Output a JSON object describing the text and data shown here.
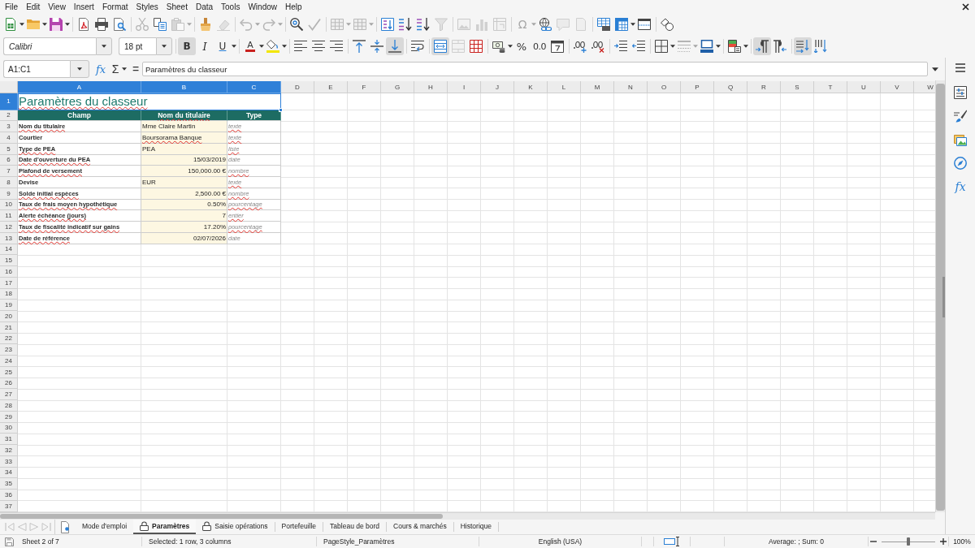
{
  "menu_bar": {
    "items": [
      "File",
      "Edit",
      "View",
      "Insert",
      "Format",
      "Styles",
      "Sheet",
      "Data",
      "Tools",
      "Window",
      "Help"
    ]
  },
  "standard_toolbar": {
    "groups": [
      [
        {
          "kind": "new",
          "disabled": false,
          "dropdown": true
        },
        {
          "kind": "open",
          "disabled": false,
          "dropdown": true
        },
        {
          "kind": "save",
          "disabled": false,
          "dropdown": true
        }
      ],
      [
        {
          "kind": "pdf",
          "disabled": false,
          "dropdown": false
        },
        {
          "kind": "print",
          "disabled": false,
          "dropdown": false
        },
        {
          "kind": "preview",
          "disabled": false,
          "dropdown": false
        }
      ],
      [
        {
          "kind": "cut",
          "disabled": true,
          "dropdown": false
        },
        {
          "kind": "copy",
          "disabled": false,
          "dropdown": false
        },
        {
          "kind": "paste",
          "disabled": true,
          "dropdown": true
        }
      ],
      [
        {
          "kind": "clone",
          "disabled": false,
          "dropdown": false
        },
        {
          "kind": "clear",
          "disabled": true,
          "dropdown": false
        }
      ],
      [
        {
          "kind": "undo",
          "disabled": true,
          "dropdown": true
        },
        {
          "kind": "redo",
          "disabled": true,
          "dropdown": true
        }
      ],
      [
        {
          "kind": "find",
          "disabled": false,
          "dropdown": false
        },
        {
          "kind": "spelling",
          "disabled": true,
          "dropdown": false
        }
      ],
      [
        {
          "kind": "rows",
          "disabled": true,
          "dropdown": true
        },
        {
          "kind": "columns",
          "disabled": true,
          "dropdown": true
        }
      ],
      [
        {
          "kind": "sort",
          "disabled": false,
          "dropdown": false
        },
        {
          "kind": "ascending",
          "disabled": false,
          "dropdown": false
        },
        {
          "kind": "descending",
          "disabled": false,
          "dropdown": false
        },
        {
          "kind": "filter",
          "disabled": true,
          "dropdown": false
        }
      ],
      [
        {
          "kind": "image",
          "disabled": true,
          "dropdown": false
        },
        {
          "kind": "chart",
          "disabled": true,
          "dropdown": false
        },
        {
          "kind": "pivot",
          "disabled": true,
          "dropdown": false
        }
      ],
      [
        {
          "kind": "symbol",
          "label": "Ω",
          "disabled": true,
          "dropdown": true
        },
        {
          "kind": "hyperlink",
          "disabled": false,
          "dropdown": false
        },
        {
          "kind": "comment",
          "disabled": true,
          "dropdown": false
        },
        {
          "kind": "headers",
          "disabled": true,
          "dropdown": false
        }
      ],
      [
        {
          "kind": "printarea",
          "disabled": false,
          "dropdown": false
        },
        {
          "kind": "freeze",
          "disabled": false,
          "dropdown": true
        },
        {
          "kind": "split",
          "disabled": false,
          "dropdown": false
        }
      ],
      [
        {
          "kind": "draw",
          "disabled": false,
          "dropdown": false
        }
      ]
    ]
  },
  "formatting_toolbar": {
    "font_name": "Calibri",
    "font_size": "18 pt",
    "groups": [
      [
        {
          "kind": "bold",
          "label": "B",
          "on": true,
          "disabled": false,
          "dropdown": false
        },
        {
          "kind": "italic",
          "label": "I",
          "on": false,
          "disabled": false,
          "dropdown": false
        },
        {
          "kind": "underline",
          "label": "U",
          "on": false,
          "disabled": false,
          "dropdown": true
        }
      ],
      [
        {
          "kind": "fontcolor",
          "label": "A",
          "on": false,
          "disabled": false,
          "dropdown": true
        },
        {
          "kind": "highlight",
          "on": false,
          "disabled": false,
          "dropdown": true
        }
      ],
      [
        {
          "kind": "left",
          "on": false,
          "disabled": false,
          "dropdown": false
        },
        {
          "kind": "center",
          "on": false,
          "disabled": false,
          "dropdown": false
        },
        {
          "kind": "right",
          "on": false,
          "disabled": false,
          "dropdown": false
        }
      ],
      [
        {
          "kind": "top",
          "on": false,
          "disabled": false,
          "dropdown": false
        },
        {
          "kind": "middle",
          "on": false,
          "disabled": false,
          "dropdown": false
        },
        {
          "kind": "bottom",
          "on": true,
          "disabled": false,
          "dropdown": false
        }
      ],
      [
        {
          "kind": "wrap",
          "on": false,
          "disabled": false,
          "dropdown": false
        }
      ],
      [
        {
          "kind": "merge",
          "on": true,
          "disabled": false,
          "dropdown": false
        },
        {
          "kind": "mergecells",
          "on": false,
          "disabled": true,
          "dropdown": false
        },
        {
          "kind": "unmerge",
          "on": false,
          "disabled": false,
          "dropdown": false
        }
      ],
      [
        {
          "kind": "currency",
          "on": false,
          "disabled": false,
          "dropdown": true
        },
        {
          "kind": "percent",
          "label": "%",
          "on": false,
          "disabled": false,
          "dropdown": false
        },
        {
          "kind": "number",
          "label": "0.0",
          "on": false,
          "disabled": false,
          "dropdown": false
        },
        {
          "kind": "date",
          "on": false,
          "disabled": false,
          "dropdown": false
        }
      ],
      [
        {
          "kind": "adddecimal",
          "on": false,
          "disabled": false,
          "dropdown": false
        },
        {
          "kind": "deletedecimal",
          "on": false,
          "disabled": false,
          "dropdown": false
        }
      ],
      [
        {
          "kind": "indent",
          "on": false,
          "disabled": false,
          "dropdown": false
        },
        {
          "kind": "outdent",
          "on": false,
          "disabled": false,
          "dropdown": false
        }
      ],
      [
        {
          "kind": "borders",
          "on": false,
          "disabled": false,
          "dropdown": true
        },
        {
          "kind": "borderstyle",
          "on": false,
          "disabled": true,
          "dropdown": true
        },
        {
          "kind": "bordercolor",
          "on": false,
          "disabled": false,
          "dropdown": true
        }
      ],
      [
        {
          "kind": "conditional",
          "on": false,
          "disabled": false,
          "dropdown": true
        }
      ],
      [
        {
          "kind": "ltr",
          "on": true,
          "disabled": false,
          "dropdown": false
        },
        {
          "kind": "rtl",
          "on": false,
          "disabled": false,
          "dropdown": false
        }
      ],
      [
        {
          "kind": "horizontal",
          "on": true,
          "disabled": false,
          "dropdown": false
        },
        {
          "kind": "vertical",
          "on": false,
          "disabled": false,
          "dropdown": false
        }
      ]
    ]
  },
  "formula_bar": {
    "name_box": "A1:C1",
    "function_wizard": "fx",
    "sum": "Σ",
    "formula": "=",
    "content": "Paramètres du classeur"
  },
  "sheet": {
    "column_headers": [
      {
        "label": "A",
        "selected": true
      },
      {
        "label": "B",
        "selected": true
      },
      {
        "label": "C",
        "selected": true
      },
      {
        "label": "D",
        "selected": false
      },
      {
        "label": "E",
        "selected": false
      },
      {
        "label": "F",
        "selected": false
      },
      {
        "label": "G",
        "selected": false
      },
      {
        "label": "H",
        "selected": false
      },
      {
        "label": "I",
        "selected": false
      },
      {
        "label": "J",
        "selected": false
      },
      {
        "label": "K",
        "selected": false
      },
      {
        "label": "L",
        "selected": false
      },
      {
        "label": "M",
        "selected": false
      },
      {
        "label": "N",
        "selected": false
      },
      {
        "label": "O",
        "selected": false
      },
      {
        "label": "P",
        "selected": false
      },
      {
        "label": "Q",
        "selected": false
      },
      {
        "label": "R",
        "selected": false
      },
      {
        "label": "S",
        "selected": false
      },
      {
        "label": "T",
        "selected": false
      },
      {
        "label": "U",
        "selected": false
      },
      {
        "label": "V",
        "selected": false
      },
      {
        "label": "W",
        "selected": false
      }
    ],
    "row_headers": [
      {
        "label": "1",
        "selected": true
      },
      {
        "label": "2",
        "selected": false
      },
      {
        "label": "3",
        "selected": false
      },
      {
        "label": "4",
        "selected": false
      },
      {
        "label": "5",
        "selected": false
      },
      {
        "label": "6",
        "selected": false
      },
      {
        "label": "7",
        "selected": false
      },
      {
        "label": "8",
        "selected": false
      },
      {
        "label": "9",
        "selected": false
      },
      {
        "label": "10",
        "selected": false
      },
      {
        "label": "11",
        "selected": false
      },
      {
        "label": "12",
        "selected": false
      },
      {
        "label": "13",
        "selected": false
      },
      {
        "label": "14",
        "selected": false
      },
      {
        "label": "15",
        "selected": false
      },
      {
        "label": "16",
        "selected": false
      },
      {
        "label": "17",
        "selected": false
      },
      {
        "label": "18",
        "selected": false
      },
      {
        "label": "19",
        "selected": false
      },
      {
        "label": "20",
        "selected": false
      },
      {
        "label": "21",
        "selected": false
      },
      {
        "label": "22",
        "selected": false
      },
      {
        "label": "23",
        "selected": false
      },
      {
        "label": "24",
        "selected": false
      },
      {
        "label": "25",
        "selected": false
      },
      {
        "label": "26",
        "selected": false
      },
      {
        "label": "27",
        "selected": false
      },
      {
        "label": "28",
        "selected": false
      },
      {
        "label": "29",
        "selected": false
      },
      {
        "label": "30",
        "selected": false
      },
      {
        "label": "31",
        "selected": false
      },
      {
        "label": "32",
        "selected": false
      },
      {
        "label": "33",
        "selected": false
      },
      {
        "label": "34",
        "selected": false
      },
      {
        "label": "35",
        "selected": false
      },
      {
        "label": "36",
        "selected": false
      },
      {
        "label": "37",
        "selected": false
      }
    ],
    "title": {
      "text": "Paramètres du classeur",
      "misspelled": true,
      "selected": true
    },
    "headings": [
      {
        "text": "Champ",
        "misspelled": false
      },
      {
        "text": "Nom du titulaire",
        "misspelled": true
      },
      {
        "text": "Type",
        "misspelled": false
      }
    ],
    "records": [
      {
        "cells": [
          {
            "text": "Nom du titulaire",
            "misspelled": true,
            "right_aligned": false
          },
          {
            "text": "Mme Claire Martin",
            "misspelled": false,
            "right_aligned": false
          },
          {
            "text": "texte",
            "misspelled": true,
            "right_aligned": false
          }
        ]
      },
      {
        "cells": [
          {
            "text": "Courtier",
            "misspelled": false,
            "right_aligned": false
          },
          {
            "text": "Boursorama Banque",
            "misspelled": true,
            "right_aligned": false
          },
          {
            "text": "texte",
            "misspelled": true,
            "right_aligned": false
          }
        ]
      },
      {
        "cells": [
          {
            "text": "Type de PEA",
            "misspelled": true,
            "right_aligned": false
          },
          {
            "text": "PEA",
            "misspelled": false,
            "right_aligned": false
          },
          {
            "text": "liste",
            "misspelled": true,
            "right_aligned": false
          }
        ]
      },
      {
        "cells": [
          {
            "text": "Date d'ouverture du PEA",
            "misspelled": true,
            "right_aligned": false
          },
          {
            "text": "15/03/2019",
            "misspelled": false,
            "right_aligned": true
          },
          {
            "text": "date",
            "misspelled": false,
            "right_aligned": false
          }
        ]
      },
      {
        "cells": [
          {
            "text": "Plafond de versement",
            "misspelled": true,
            "right_aligned": false
          },
          {
            "text": "150,000.00 €",
            "misspelled": false,
            "right_aligned": true
          },
          {
            "text": "nombre",
            "misspelled": true,
            "right_aligned": false
          }
        ]
      },
      {
        "cells": [
          {
            "text": "Devise",
            "misspelled": false,
            "right_aligned": false
          },
          {
            "text": "EUR",
            "misspelled": false,
            "right_aligned": false
          },
          {
            "text": "texte",
            "misspelled": true,
            "right_aligned": false
          }
        ]
      },
      {
        "cells": [
          {
            "text": "Solde initial espèces",
            "misspelled": true,
            "right_aligned": false
          },
          {
            "text": "2,500.00 €",
            "misspelled": false,
            "right_aligned": true
          },
          {
            "text": "nombre",
            "misspelled": true,
            "right_aligned": false
          }
        ]
      },
      {
        "cells": [
          {
            "text": "Taux de frais moyen hypothétique",
            "misspelled": true,
            "right_aligned": false
          },
          {
            "text": "0.50%",
            "misspelled": false,
            "right_aligned": true
          },
          {
            "text": "pourcentage",
            "misspelled": true,
            "right_aligned": false
          }
        ]
      },
      {
        "cells": [
          {
            "text": "Alerte échéance (jours)",
            "misspelled": true,
            "right_aligned": false
          },
          {
            "text": "7",
            "misspelled": false,
            "right_aligned": true
          },
          {
            "text": "entier",
            "misspelled": true,
            "right_aligned": false
          }
        ]
      },
      {
        "cells": [
          {
            "text": "Taux de fiscalité indicatif sur gains",
            "misspelled": true,
            "right_aligned": false
          },
          {
            "text": "17.20%",
            "misspelled": false,
            "right_aligned": true
          },
          {
            "text": "pourcentage",
            "misspelled": true,
            "right_aligned": false
          }
        ]
      },
      {
        "cells": [
          {
            "text": "Date de référence",
            "misspelled": true,
            "right_aligned": false
          },
          {
            "text": "02/07/2026",
            "misspelled": false,
            "right_aligned": true
          },
          {
            "text": "date",
            "misspelled": false,
            "right_aligned": false
          }
        ]
      }
    ]
  },
  "sidebar": {
    "functions": "fx"
  },
  "sheet_tabs": {
    "navigation": [
      {
        "kind": "first",
        "disabled": true
      },
      {
        "kind": "previous",
        "disabled": true
      },
      {
        "kind": "next",
        "disabled": true
      },
      {
        "kind": "last",
        "disabled": true
      }
    ],
    "tabs": [
      {
        "label": "Mode d'emploi",
        "selected": false,
        "locked": false
      },
      {
        "label": "Paramètres",
        "selected": true,
        "locked": true
      },
      {
        "label": "Saisie opérations",
        "selected": false,
        "locked": true
      },
      {
        "label": "Portefeuille",
        "selected": false,
        "locked": false
      },
      {
        "label": "Tableau de bord",
        "selected": false,
        "locked": false
      },
      {
        "label": "Cours & marchés",
        "selected": false,
        "locked": false
      },
      {
        "label": "Historique",
        "selected": false,
        "locked": false
      }
    ]
  },
  "status_bar": {
    "sheet_position": "Sheet 2 of 7",
    "selection": "Selected: 1 row, 3 columns",
    "page_style": "PageStyle_Paramètres",
    "language": "English (USA)",
    "summary": "Average: ; Sum: 0",
    "zoom": {
      "level": 0.5,
      "reading": "100%"
    }
  }
}
